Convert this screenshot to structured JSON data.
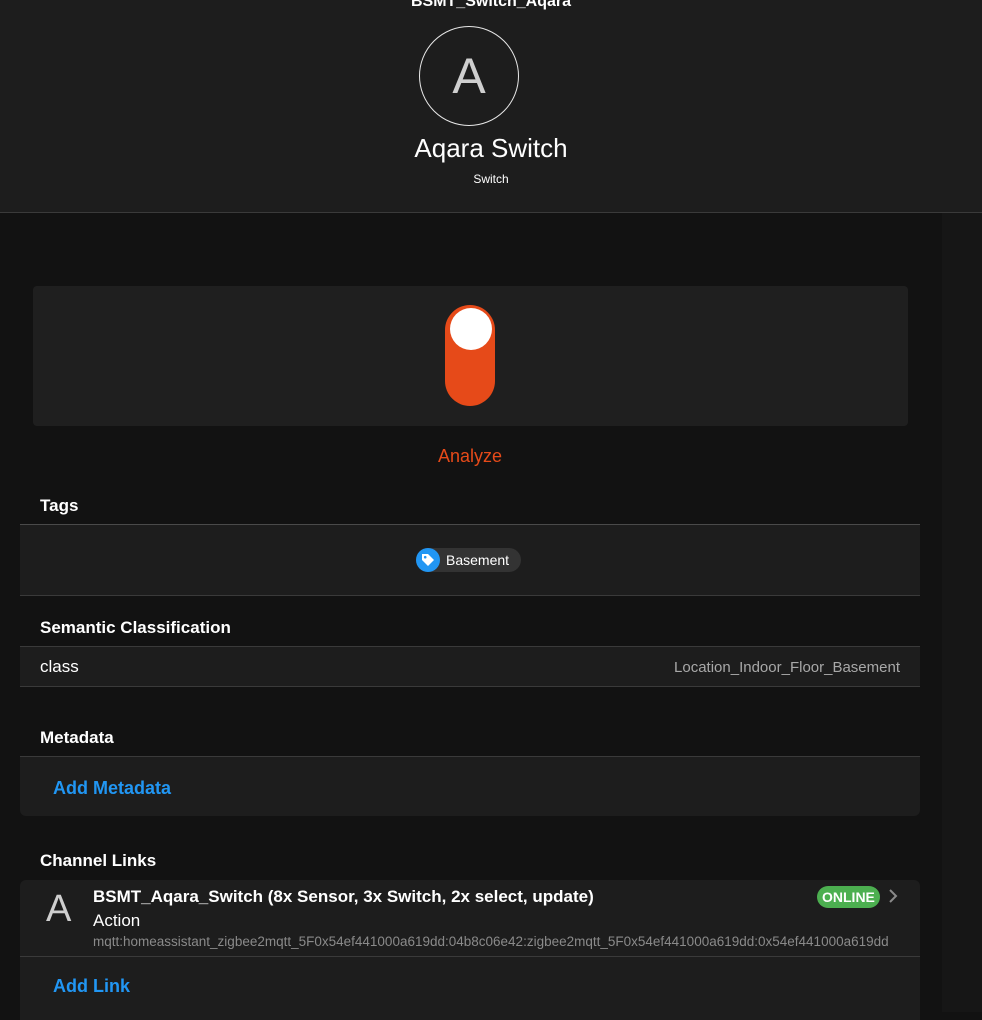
{
  "header": {
    "top_label": "BSMT_Switch_Aqara",
    "avatar_letter": "A",
    "title": "Aqara Switch",
    "subtitle": "Switch"
  },
  "control": {
    "toggle_state": "on",
    "accent_color": "#e64a19",
    "analyze_label": "Analyze"
  },
  "tags": {
    "title": "Tags",
    "items": [
      {
        "label": "Basement",
        "icon": "tag-icon",
        "icon_color": "#2196f3"
      }
    ]
  },
  "semantic": {
    "title": "Semantic Classification",
    "key": "class",
    "value": "Location_Indoor_Floor_Basement"
  },
  "metadata": {
    "title": "Metadata",
    "add_label": "Add Metadata"
  },
  "channel_links": {
    "title": "Channel Links",
    "items": [
      {
        "avatar_letter": "A",
        "title": "BSMT_Aqara_Switch (8x Sensor, 3x Switch, 2x select, update)",
        "subtitle": "Action",
        "uid": "mqtt:homeassistant_zigbee2mqtt_5F0x54ef441000a619dd:04b8c06e42:zigbee2mqtt_5F0x54ef441000a619dd:0x54ef441000a619dd",
        "status": "ONLINE",
        "status_color": "#4caf50"
      }
    ],
    "add_label": "Add Link"
  }
}
